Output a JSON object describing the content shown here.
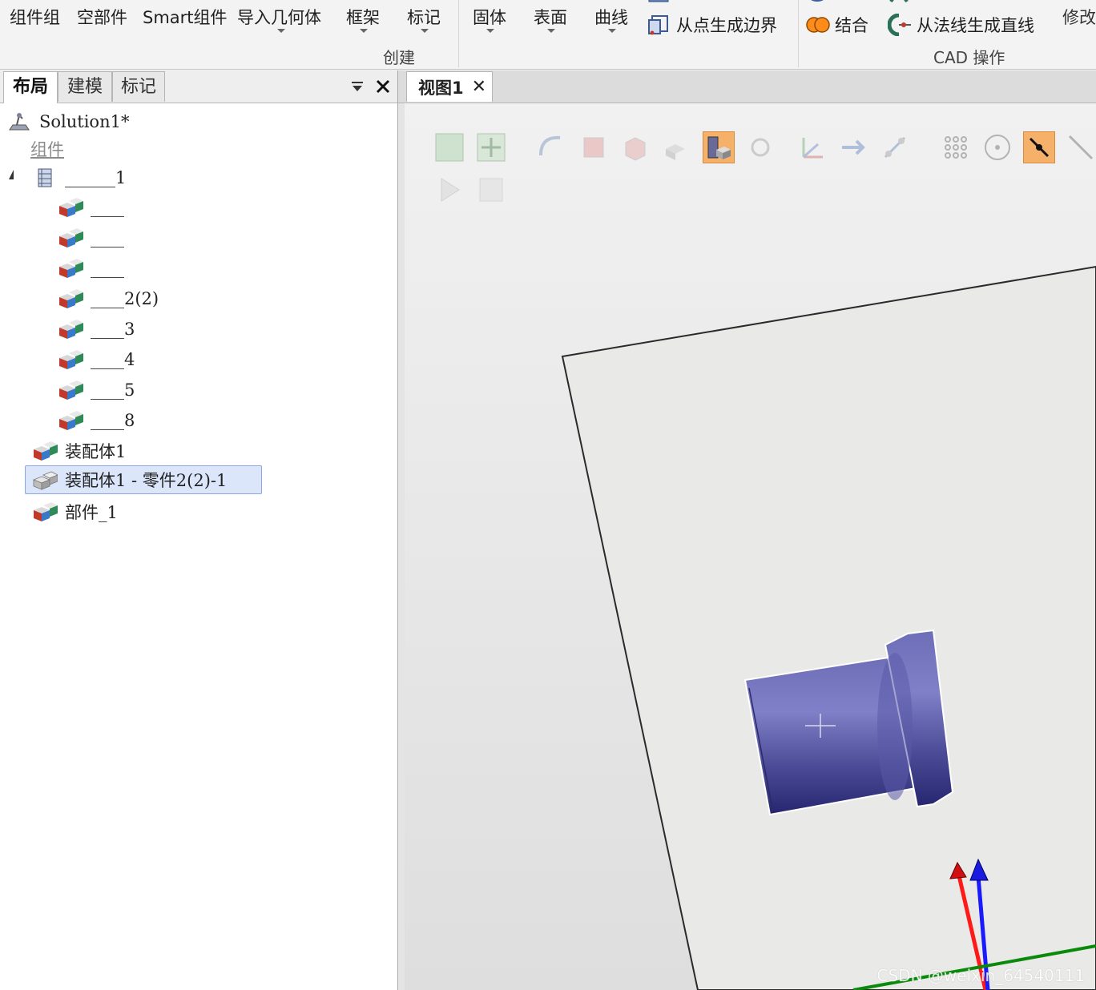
{
  "ribbon": {
    "create_items": [
      {
        "label": "组件组"
      },
      {
        "label": "空部件"
      },
      {
        "label": "Smart组件"
      },
      {
        "label": "导入几何体"
      },
      {
        "label": "框架"
      },
      {
        "label": "标记"
      },
      {
        "label": "固体"
      },
      {
        "label": "表面"
      },
      {
        "label": "曲线"
      }
    ],
    "surface_boundary_label": "从点生成边界",
    "create_group_label": "创建",
    "cad_union_label": "结合",
    "cad_normal_line_label": "从法线生成直线",
    "cad_group_label": "CAD 操作",
    "modify_label": "修改",
    "accent_orange": "#f5a155",
    "union_icon_color": "#ff8c1a"
  },
  "left_panel": {
    "tabs": [
      {
        "label": "布局",
        "active": true
      },
      {
        "label": "建模",
        "active": false
      },
      {
        "label": "标记",
        "active": false
      }
    ],
    "tree": {
      "root": "Solution1*",
      "section_header": "组件",
      "group_label": "______1",
      "children": [
        {
          "label": "____"
        },
        {
          "label": "____"
        },
        {
          "label": "____"
        },
        {
          "label": "____2(2)"
        },
        {
          "label": "____3"
        },
        {
          "label": "____4"
        },
        {
          "label": "____5"
        },
        {
          "label": "____8"
        }
      ],
      "top_items": [
        {
          "label": "装配体1",
          "selected": false
        },
        {
          "label": "装配体1 - 零件2(2)-1",
          "selected": true
        },
        {
          "label": "部件_1",
          "selected": false
        }
      ]
    }
  },
  "viewport": {
    "tab_label": "视图1",
    "toolbar_row1": [
      "view-all-icon",
      "zoom-fit-icon",
      "select-curve-icon",
      "select-surface-icon",
      "select-body-icon",
      "select-part-icon",
      "select-group-icon",
      "select-target-icon",
      "snap-frame-icon",
      "snap-align-icon",
      "snap-edge-icon",
      "snap-grid-icon",
      "snap-center-icon",
      "snap-endpoint-icon",
      "snap-line-icon"
    ],
    "toolbar_active": [
      "select-group-icon",
      "snap-endpoint-icon"
    ],
    "toolbar_row2": [
      "play-icon",
      "stop-icon"
    ],
    "part_color": "#5a5aa8",
    "watermark": "CSDN @weixin_64540111"
  }
}
